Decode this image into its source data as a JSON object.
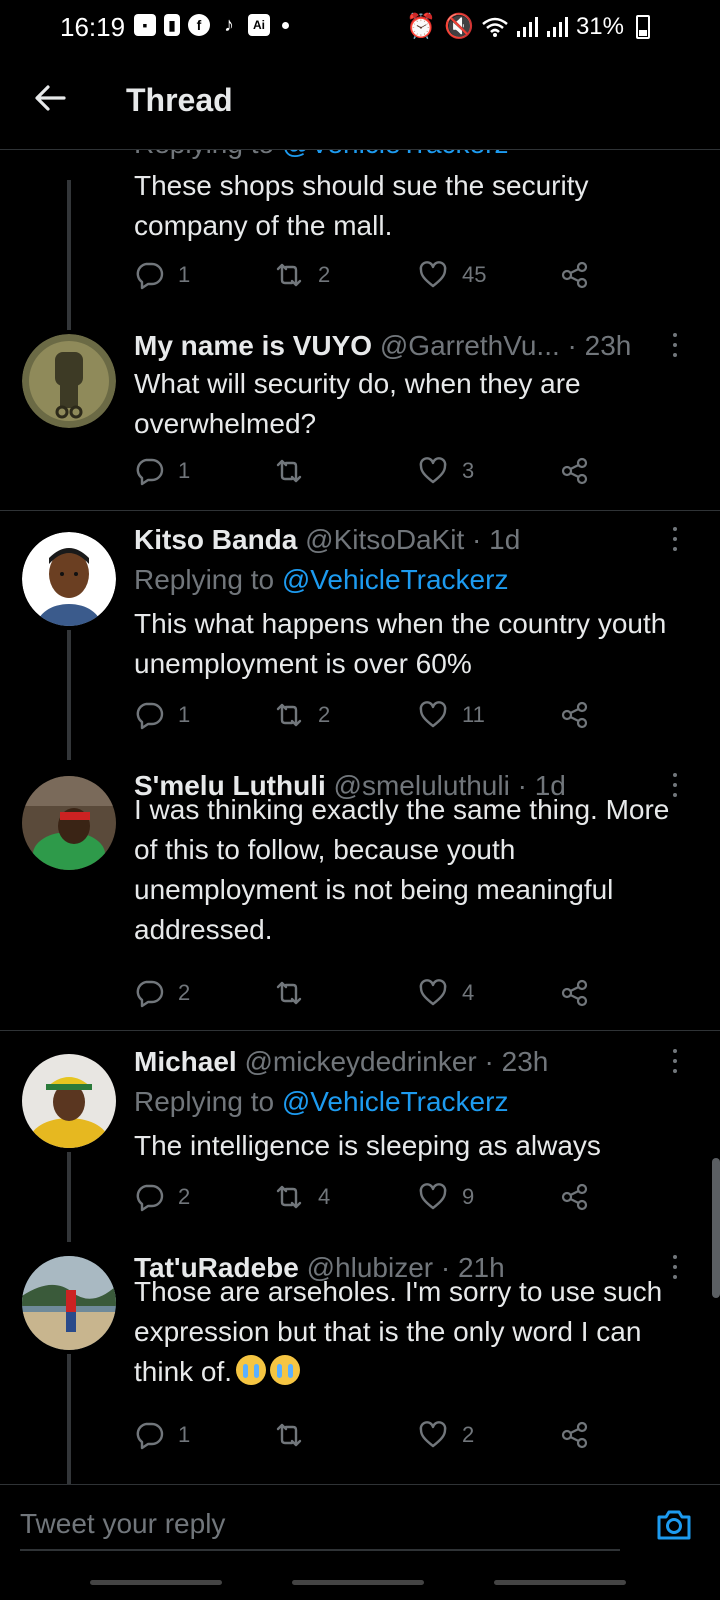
{
  "status_bar": {
    "time": "16:19",
    "battery": "31%",
    "left_icons": [
      "message-icon",
      "sim-icon",
      "facebook-icon",
      "tiktok-icon",
      "ai-icon",
      "dot-icon"
    ],
    "right_icons": [
      "alarm-icon",
      "mute-icon",
      "wifi-icon",
      "signal-icon",
      "signal-icon",
      "battery-icon"
    ]
  },
  "header": {
    "title": "Thread"
  },
  "tweets": [
    {
      "cut_top": {
        "replying": "Replying to",
        "handle": "@VehicleTrackerz"
      },
      "text": "These shops should sue the security company of the mall.",
      "replies": "1",
      "retweets": "2",
      "likes": "45"
    },
    {
      "name": "My name is VUYO",
      "meta": "@GarrethVu... · 23h",
      "text": "What will security do, when they are overwhelmed?",
      "replies": "1",
      "retweets": "",
      "likes": "3"
    },
    {
      "name": "Kitso Banda",
      "meta": "@KitsoDaKit · 1d",
      "replying": "Replying to",
      "handle": "@VehicleTrackerz",
      "text": "This what happens when the country youth unemployment is over 60%",
      "replies": "1",
      "retweets": "2",
      "likes": "11"
    },
    {
      "name": "S'melu Luthuli",
      "meta": "@smeluluthuli · 1d",
      "text": "I was thinking exactly the same thing. More of this to follow, because youth unemployment is not being meaningful addressed.",
      "replies": "2",
      "retweets": "",
      "likes": "4"
    },
    {
      "name": "Michael",
      "meta": "@mickeydedrinker · 23h",
      "replying": "Replying to",
      "handle": "@VehicleTrackerz",
      "text": "The intelligence is sleeping as always",
      "replies": "2",
      "retweets": "4",
      "likes": "9"
    },
    {
      "name": "Tat'uRadebe",
      "meta": "@hlubizer · 21h",
      "text": "Those are arseholes. I'm sorry to use such expression but that is the only word I can think of.",
      "emoji_count": 2,
      "replies": "1",
      "retweets": "",
      "likes": "2"
    }
  ],
  "reply_bar": {
    "placeholder": "Tweet your reply"
  },
  "colors": {
    "accent": "#1d9bf0",
    "muted": "#71767b",
    "text": "#e7e9ea",
    "background": "#000000"
  }
}
